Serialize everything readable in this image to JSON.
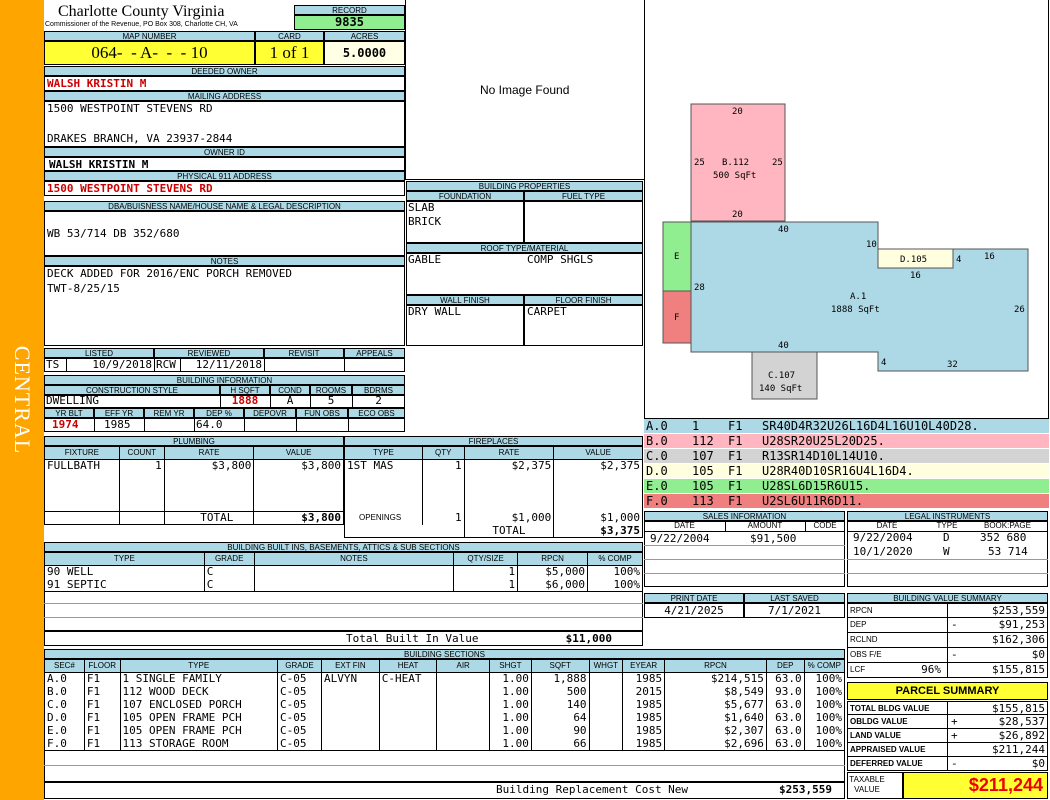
{
  "sidebar": {
    "label": "CENTRAL",
    "color": "#ffa500"
  },
  "header": {
    "county": "Charlotte County Virginia",
    "office": "Commissioner of the Revenue, PO Box 308, Charlotte CH, VA",
    "record_label": "RECORD",
    "record": "9835",
    "map_label": "MAP NUMBER",
    "map_number": "064-  - A-  -  - 10",
    "card_label": "CARD",
    "card": "1 of 1",
    "acres_label": "ACRES",
    "acres": "5.0000"
  },
  "owner": {
    "deeded_label": "DEEDED OWNER",
    "deeded": "WALSH KRISTIN M",
    "mailing_label": "MAILING ADDRESS",
    "mailing_line1": "1500 WESTPOINT STEVENS RD",
    "mailing_line2": "DRAKES BRANCH, VA 23937-2844",
    "owner_id_label": "OWNER ID",
    "owner_id": "WALSH KRISTIN M",
    "physical_label": "PHYSICAL 911 ADDRESS",
    "physical": "1500 WESTPOINT STEVENS RD",
    "legal_label": "DBA/BUISNESS NAME/HOUSE NAME & LEGAL DESCRIPTION",
    "legal": "WB 53/714 DB 352/680",
    "notes_label": "NOTES",
    "notes_line1": "DECK ADDED FOR 2016/ENC PORCH REMOVED",
    "notes_line2": "TWT-8/25/15"
  },
  "image": {
    "placeholder": "No Image Found"
  },
  "building_properties": {
    "title": "BUILDING PROPERTIES",
    "foundation_label": "FOUNDATION",
    "fuel_label": "FUEL TYPE",
    "foundation1": "SLAB",
    "foundation2": "BRICK",
    "fuel": "",
    "roof_label": "ROOF TYPE/MATERIAL",
    "roof_type": "GABLE",
    "roof_material": "COMP SHGLS",
    "wall_label": "WALL FINISH",
    "floor_label": "FLOOR FINISH",
    "wall": "DRY WALL",
    "floor": "CARPET"
  },
  "review": {
    "listed_label": "LISTED",
    "reviewed_label": "REVIEWED",
    "revisit_label": "REVISIT",
    "appeals_label": "APPEALS",
    "listed_by": "TS",
    "listed_date": "10/9/2018",
    "reviewed_by": "RCW",
    "reviewed_date": "12/11/2018"
  },
  "building_info": {
    "title": "BUILDING INFORMATION",
    "style_label": "CONSTRUCTION STYLE",
    "hsqft_label": "H SQFT",
    "cond_label": "COND",
    "rooms_label": "ROOMS",
    "bdrms_label": "BDRMS",
    "style": "DWELLING",
    "hsqft": "1888",
    "cond": "A",
    "rooms": "5",
    "bdrms": "2",
    "yrblt_label": "YR BLT",
    "effyr_label": "EFF YR",
    "remyr_label": "REM YR",
    "dep_label": "DEP %",
    "depovr_label": "DEPOVR",
    "funobs_label": "FUN OBS",
    "ecoobs_label": "ECO OBS",
    "yrblt": "1974",
    "effyr": "1985",
    "remyr": "",
    "dep": "64.0"
  },
  "plumbing": {
    "title": "PLUMBING",
    "headers": [
      "FIXTURE",
      "COUNT",
      "RATE",
      "VALUE"
    ],
    "rows": [
      [
        "FULLBATH",
        "1",
        "$3,800",
        "$3,800"
      ]
    ],
    "total_label": "TOTAL",
    "total": "$3,800"
  },
  "fireplaces": {
    "title": "FIREPLACES",
    "headers": [
      "TYPE",
      "QTY",
      "RATE",
      "VALUE"
    ],
    "rows": [
      [
        "1ST MAS",
        "1",
        "$2,375",
        "$2,375"
      ]
    ],
    "openings_label": "OPENINGS",
    "openings": [
      "1",
      "$1,000",
      "$1,000"
    ],
    "total_label": "TOTAL",
    "total": "$3,375"
  },
  "built_ins": {
    "title": "BUILDING BUILT INS, BASEMENTS, ATTICS & SUB SECTIONS",
    "headers": [
      "TYPE",
      "GRADE",
      "NOTES",
      "QTY/SIZE",
      "RPCN",
      "% COMP"
    ],
    "rows": [
      [
        "90 WELL",
        "C",
        "",
        "1",
        "$5,000",
        "100%"
      ],
      [
        "91 SEPTIC",
        "C",
        "",
        "1",
        "$6,000",
        "100%"
      ]
    ],
    "total_label": "Total Built In Value",
    "total": "$11,000"
  },
  "sections": {
    "title": "BUILDING SECTIONS",
    "headers": [
      "SEC#",
      "FLOOR",
      "TYPE",
      "GRADE",
      "EXT FIN",
      "HEAT",
      "AIR",
      "SHGT",
      "SQFT",
      "WHGT",
      "EYEAR",
      "RPCN",
      "DEP",
      "% COMP"
    ],
    "rows": [
      [
        "A.0",
        "F1",
        "1 SINGLE FAMILY",
        "C-05",
        "ALVYN",
        "C-HEAT",
        "",
        "1.00",
        "1,888",
        "",
        "1985",
        "$214,515",
        "63.0",
        "100%"
      ],
      [
        "B.0",
        "F1",
        "112 WOOD DECK",
        "C-05",
        "",
        "",
        "",
        "1.00",
        "500",
        "",
        "2015",
        "$8,549",
        "93.0",
        "100%"
      ],
      [
        "C.0",
        "F1",
        "107 ENCLOSED PORCH",
        "C-05",
        "",
        "",
        "",
        "1.00",
        "140",
        "",
        "1985",
        "$5,677",
        "63.0",
        "100%"
      ],
      [
        "D.0",
        "F1",
        "105 OPEN FRAME PCH",
        "C-05",
        "",
        "",
        "",
        "1.00",
        "64",
        "",
        "1985",
        "$1,640",
        "63.0",
        "100%"
      ],
      [
        "E.0",
        "F1",
        "105 OPEN FRAME PCH",
        "C-05",
        "",
        "",
        "",
        "1.00",
        "90",
        "",
        "1985",
        "$2,307",
        "63.0",
        "100%"
      ],
      [
        "F.0",
        "F1",
        "113 STORAGE ROOM",
        "C-05",
        "",
        "",
        "",
        "1.00",
        "66",
        "",
        "1985",
        "$2,696",
        "63.0",
        "100%"
      ]
    ],
    "replacement_label": "Building Replacement Cost New",
    "replacement": "$253,559"
  },
  "sketch": {
    "labels": {
      "b_name": "B.112",
      "b_area": "500 SqFt",
      "b_top": "20",
      "b_left": "25",
      "b_right": "25",
      "b_bottom": "20",
      "a_name": "A.1",
      "a_area": "1888 SqFt",
      "a_top": "40",
      "a_10": "10",
      "a_16a": "16",
      "a_16b": "16",
      "a_4a": "4",
      "a_26": "26",
      "a_28": "28",
      "a_40b": "40",
      "a_4b": "4",
      "a_32": "32",
      "c_name": "C.107",
      "c_area": "140 SqFt",
      "d_name": "D.105",
      "e_name": "E",
      "f_name": "F"
    },
    "colors": {
      "a": "#add8e6",
      "b": "#ffb6c1",
      "c": "#d3d3d3",
      "d": "#ffffe0",
      "e": "#90ee90",
      "f": "#f08080"
    }
  },
  "vectors": [
    {
      "sec": "A.0",
      "num": "1",
      "fl": "F1",
      "code": "SR40D4R32U26L16D4L16U10L40D28.",
      "color": "#add8e6"
    },
    {
      "sec": "B.0",
      "num": "112",
      "fl": "F1",
      "code": "U28SR20U25L20D25.",
      "color": "#ffb6c1"
    },
    {
      "sec": "C.0",
      "num": "107",
      "fl": "F1",
      "code": "R13SR14D10L14U10.",
      "color": "#d3d3d3"
    },
    {
      "sec": "D.0",
      "num": "105",
      "fl": "F1",
      "code": "U28R40D10SR16U4L16D4.",
      "color": "#ffffe0"
    },
    {
      "sec": "E.0",
      "num": "105",
      "fl": "F1",
      "code": "U28SL6D15R6U15.",
      "color": "#90ee90"
    },
    {
      "sec": "F.0",
      "num": "113",
      "fl": "F1",
      "code": "U2SL6U11R6D11.",
      "color": "#f08080"
    }
  ],
  "sales": {
    "title": "SALES INFORMATION",
    "headers": [
      "DATE",
      "AMOUNT",
      "CODE"
    ],
    "rows": [
      [
        "9/22/2004",
        "$91,500",
        ""
      ]
    ]
  },
  "legal_instruments": {
    "title": "LEGAL INSTRUMENTS",
    "headers": [
      "DATE",
      "TYPE",
      "BOOK:PAGE"
    ],
    "rows": [
      [
        "9/22/2004",
        "D",
        "352 680"
      ],
      [
        "10/1/2020",
        "W",
        "53 714"
      ]
    ]
  },
  "dates": {
    "print_label": "PRINT DATE",
    "print": "4/21/2025",
    "saved_label": "LAST SAVED",
    "saved": "7/1/2021"
  },
  "value_summary": {
    "title": "BUILDING VALUE SUMMARY",
    "rows": [
      {
        "label": "RPCN",
        "pct": "",
        "sign": "",
        "value": "$253,559"
      },
      {
        "label": "DEP",
        "pct": "",
        "sign": "-",
        "value": "$91,253"
      },
      {
        "label": "RCLND",
        "pct": "",
        "sign": "",
        "value": "$162,306"
      },
      {
        "label": "OBS F/E",
        "pct": "",
        "sign": "-",
        "value": "$0"
      },
      {
        "label": "LCF",
        "pct": "96%",
        "sign": "",
        "value": "$155,815"
      }
    ]
  },
  "parcel_summary": {
    "title": "PARCEL SUMMARY",
    "rows": [
      {
        "label": "TOTAL BLDG VALUE",
        "sign": "",
        "value": "$155,815"
      },
      {
        "label": "OBLDG VALUE",
        "sign": "+",
        "value": "$28,537"
      },
      {
        "label": "LAND VALUE",
        "sign": "+",
        "value": "$26,892"
      },
      {
        "label": "APPRAISED VALUE",
        "sign": "",
        "value": "$211,244"
      },
      {
        "label": "DEFERRED VALUE",
        "sign": "-",
        "value": "$0"
      }
    ],
    "taxable_label1": "TAXABLE",
    "taxable_label2": "VALUE",
    "taxable": "$211,244"
  }
}
